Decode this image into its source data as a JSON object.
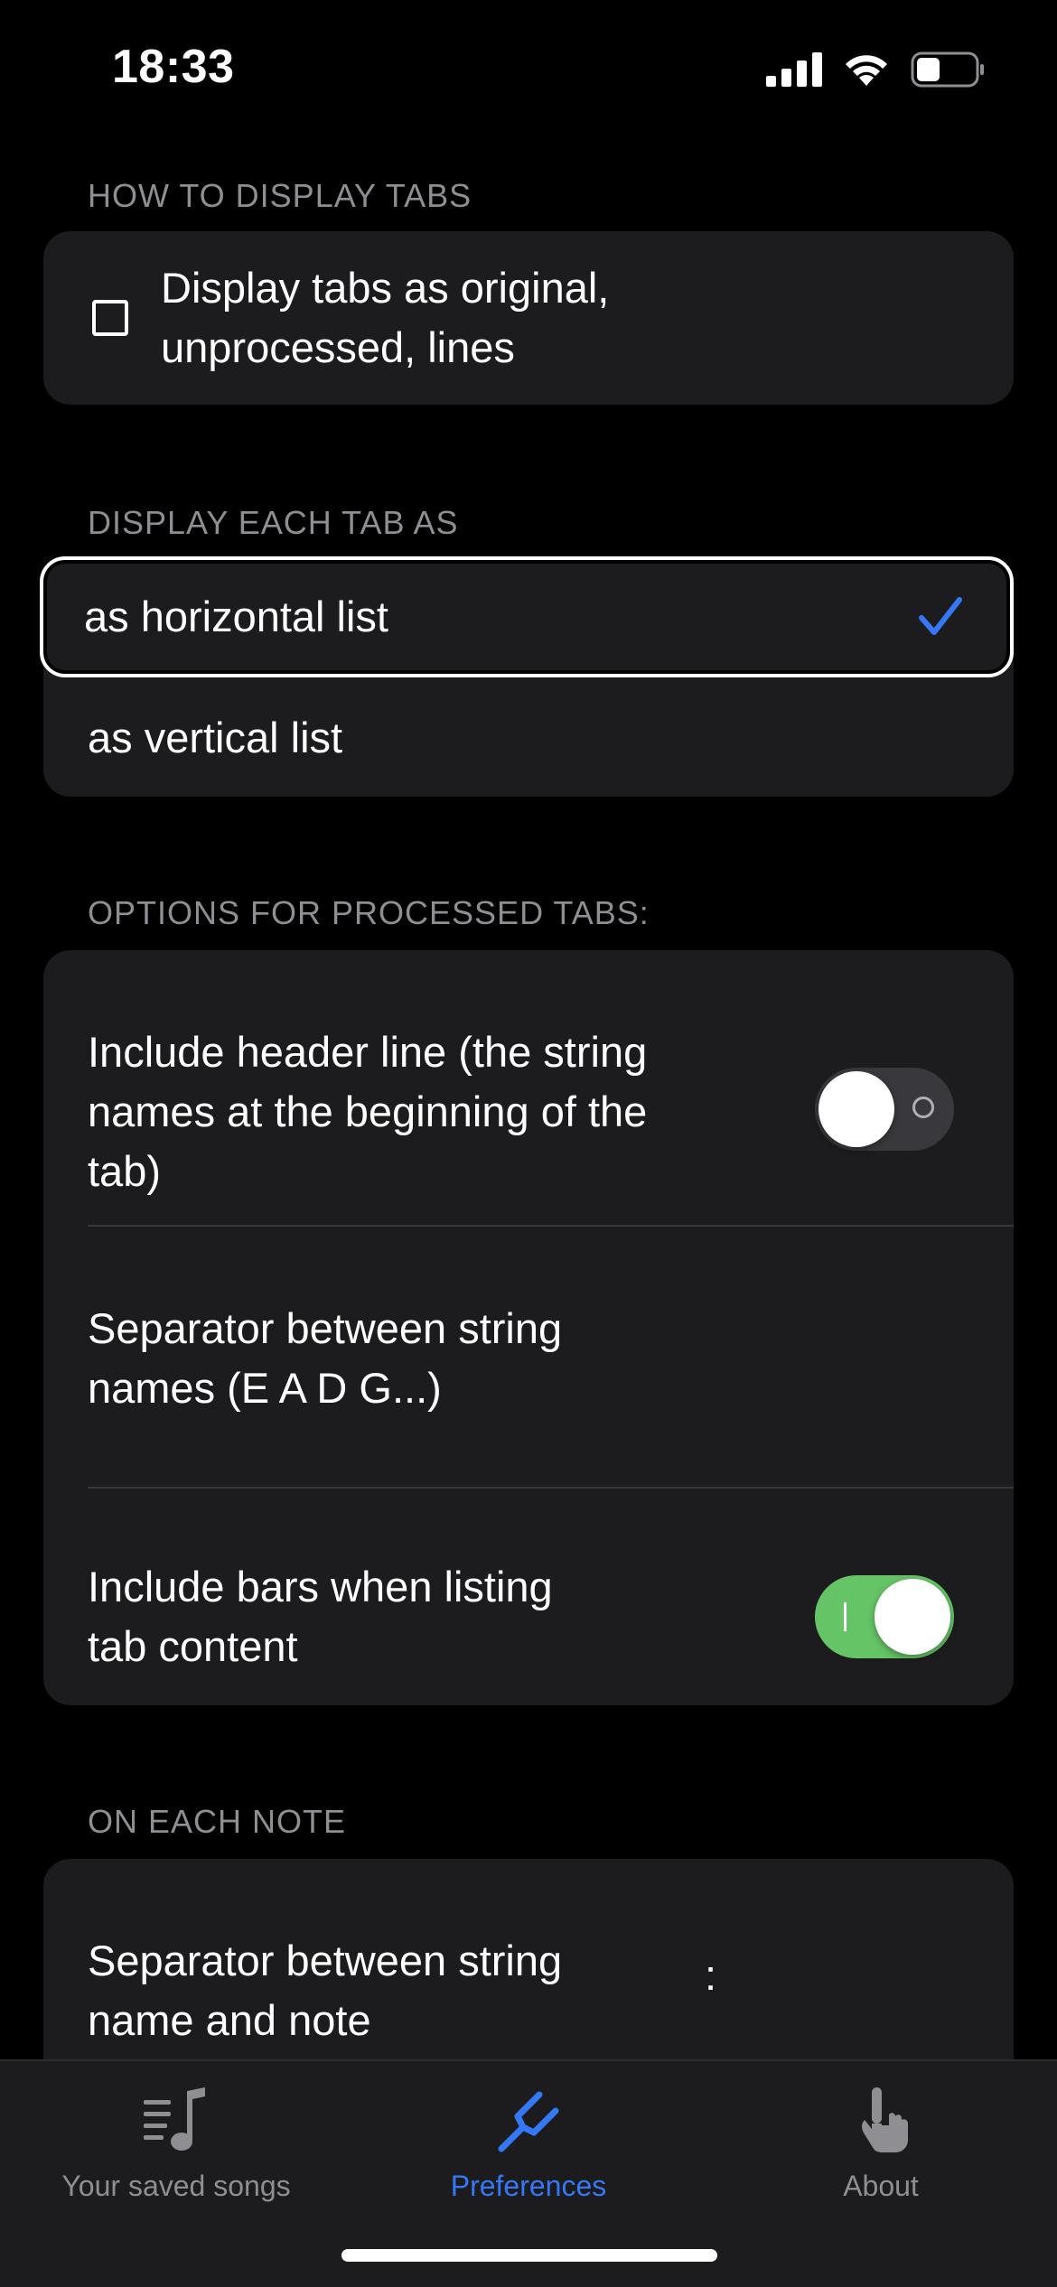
{
  "status_bar": {
    "time": "18:33"
  },
  "sections": {
    "display_tabs": {
      "header": "HOW TO DISPLAY TABS",
      "original_label_line1": "Display tabs as original,",
      "original_label_line2": "unprocessed, lines"
    },
    "display_each": {
      "header": "DISPLAY EACH TAB AS",
      "options": [
        "as horizontal list",
        "as vertical list"
      ],
      "selected": "as horizontal list"
    },
    "processed": {
      "header": "OPTIONS FOR PROCESSED TABS:",
      "header_line": {
        "line1": "Include header line (the string",
        "line2": "names at the beginning of the",
        "line3": "tab)",
        "enabled": false
      },
      "separator_names": {
        "line1": "Separator between string",
        "line2": "names (E A D G...)"
      },
      "include_bars": {
        "line1": "Include bars when listing",
        "line2": "tab content",
        "enabled": true
      }
    },
    "each_note": {
      "header": "ON EACH NOTE",
      "separator_note_line1": "Separator between string",
      "separator_note_line2": "name and note",
      "separator_note_value": ":"
    }
  },
  "tab_bar": {
    "items": [
      {
        "label": "Your saved songs",
        "icon": "music-list-icon",
        "active": false
      },
      {
        "label": "Preferences",
        "icon": "tuning-fork-icon",
        "active": true
      },
      {
        "label": "About",
        "icon": "hand-pointer-icon",
        "active": false
      }
    ]
  },
  "colors": {
    "accent": "#3478f6",
    "toggle_on": "#65c466",
    "card_bg": "#1c1c1e",
    "secondary_text": "#8e8e93"
  }
}
